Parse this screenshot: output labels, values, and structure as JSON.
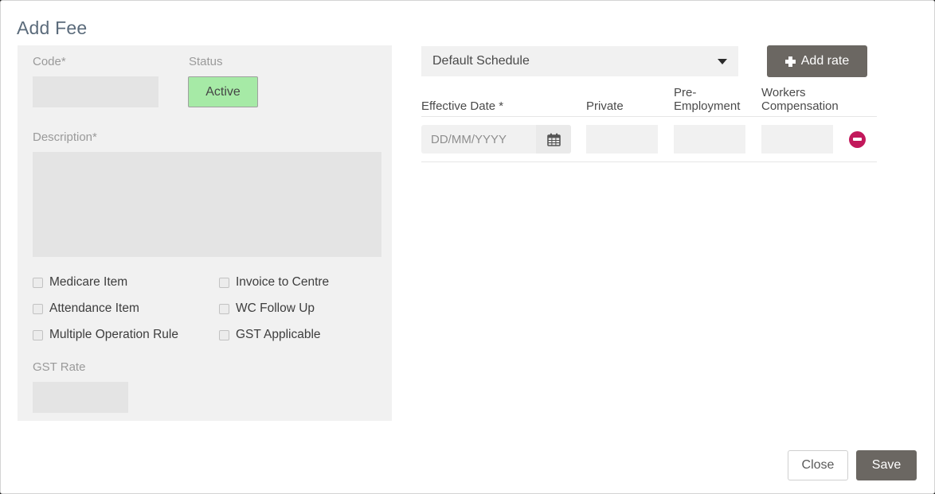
{
  "dialog": {
    "title": "Add Fee"
  },
  "form": {
    "code": {
      "label": "Code*",
      "value": ""
    },
    "status": {
      "label": "Status",
      "value": "Active",
      "color": "#a6eaa6"
    },
    "description": {
      "label": "Description*",
      "value": ""
    },
    "gst_rate": {
      "label": "GST Rate",
      "value": ""
    },
    "checkboxes": [
      {
        "label": "Medicare Item",
        "checked": false
      },
      {
        "label": "Attendance Item",
        "checked": false
      },
      {
        "label": "Multiple Operation Rule",
        "checked": false
      },
      {
        "label": "Invoice to Centre",
        "checked": false
      },
      {
        "label": "WC Follow Up",
        "checked": false
      },
      {
        "label": "GST Applicable",
        "checked": false
      }
    ]
  },
  "rates": {
    "schedule": {
      "selected": "Default Schedule"
    },
    "add_rate_label": "Add rate",
    "columns": [
      "Effective Date *",
      "Private",
      "Pre-\nEmployment",
      "Workers\nCompensation"
    ],
    "columns_display": {
      "effective_date": "Effective Date *",
      "private": "Private",
      "pre_employment_line1": "Pre-",
      "pre_employment_line2": "Employment",
      "workers_comp_line1": "Workers",
      "workers_comp_line2": "Compensation"
    },
    "rows": [
      {
        "effective_date": "",
        "effective_date_placeholder": "DD/MM/YYYY",
        "private": "",
        "pre_employment": "",
        "workers_compensation": ""
      }
    ]
  },
  "footer": {
    "close_label": "Close",
    "save_label": "Save"
  },
  "colors": {
    "title": "#5b6b7b",
    "panel": "#f1f1f1",
    "input": "#e4e4e4",
    "button_dark": "#6b6762",
    "remove": "#c2185b",
    "status_active": "#a6eaa6"
  }
}
